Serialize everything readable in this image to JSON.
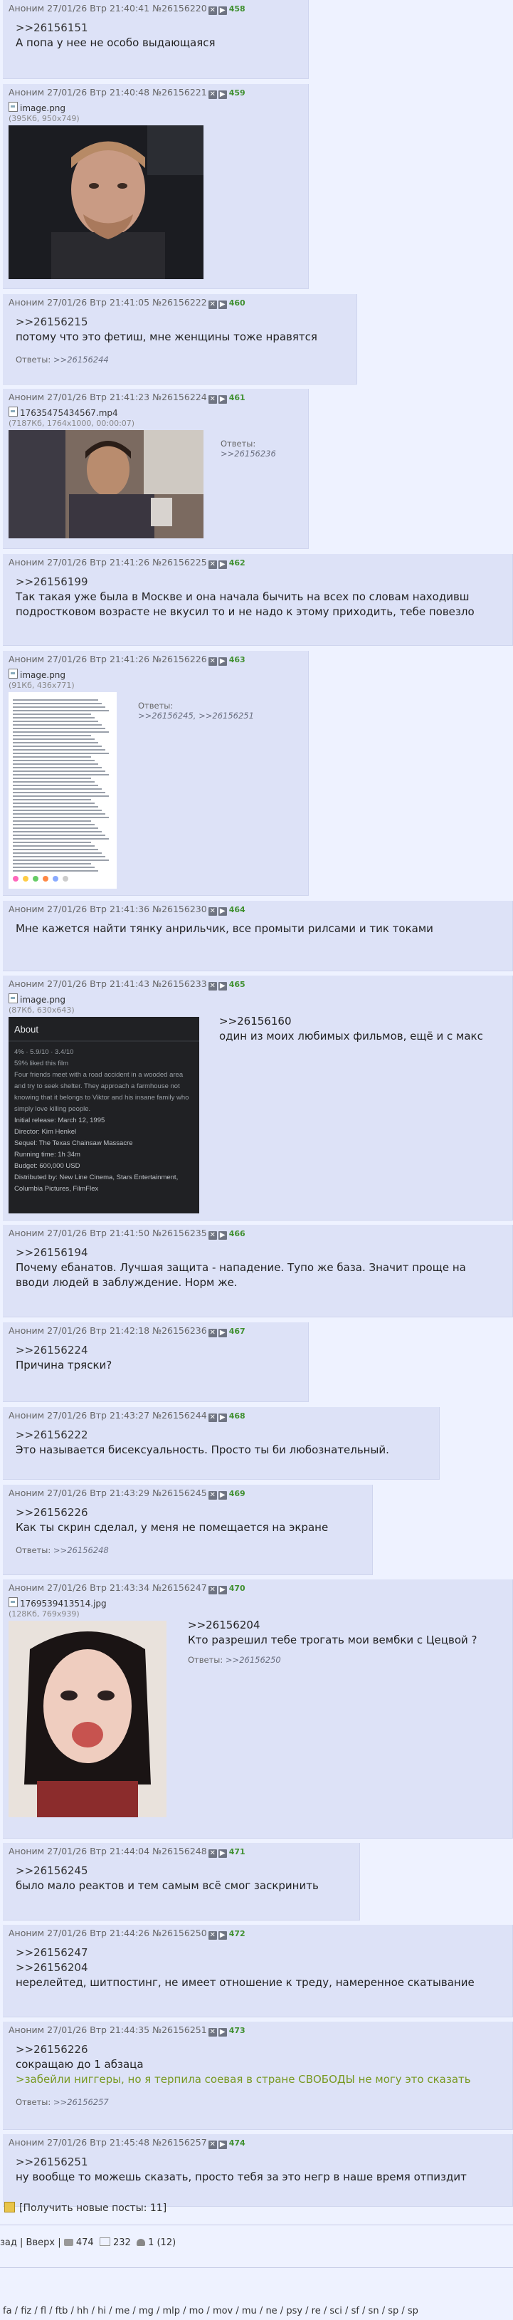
{
  "posts": [
    {
      "head": "Аноним 27/01/26 Втр 21:40:41 №26156220",
      "count": "458",
      "lines": [
        ">>26156151",
        "А попа у нее не особо выдающаяся"
      ],
      "answers": ""
    },
    {
      "head": "Аноним 27/01/26 Втр 21:40:48 №26156221",
      "count": "459",
      "file": "image.png",
      "meta": "(395Кб, 950x749)",
      "lines": [],
      "answers": ""
    },
    {
      "head": "Аноним 27/01/26 Втр 21:41:05 №26156222",
      "count": "460",
      "lines": [
        ">>26156215",
        "потому что это фетиш, мне женщины тоже нравятся"
      ],
      "answers": ">>26156244"
    },
    {
      "head": "Аноним 27/01/26 Втр 21:41:23 №26156224",
      "count": "461",
      "file": "17635475434567.mp4",
      "meta": "(7187Кб, 1764x1000, 00:00:07)",
      "lines": [],
      "answers": ">>26156236"
    },
    {
      "head": "Аноним 27/01/26 Втр 21:41:26 №26156225",
      "count": "462",
      "lines": [
        ">>26156199",
        "Так такая уже была в Москве и она начала бычить на всех по словам находивш",
        "подростковом возрасте не вкусил то и не надо к этому приходить, тебе повезло"
      ],
      "answers": ""
    },
    {
      "head": "Аноним 27/01/26 Втр 21:41:26 №26156226",
      "count": "463",
      "file": "image.png",
      "meta": "(91Кб, 436x771)",
      "lines": [],
      "answers": ">>26156245, >>26156251"
    },
    {
      "head": "Аноним 27/01/26 Втр 21:41:36 №26156230",
      "count": "464",
      "lines": [
        "Мне кажется найти тянку анрильчик, все промыти рилсами и тик токами"
      ],
      "answers": ""
    },
    {
      "head": "Аноним 27/01/26 Втр 21:41:43 №26156233",
      "count": "465",
      "file": "image.png",
      "meta": "(87Кб, 630x643)",
      "lines": [
        ">>26156160",
        "один из моих любимых фильмов, ещё и с макс"
      ],
      "answers": ""
    },
    {
      "head": "Аноним 27/01/26 Втр 21:41:50 №26156235",
      "count": "466",
      "lines": [
        ">>26156194",
        "Почему ебанатов. Лучшая защита - нападение. Тупо же база. Значит проще на",
        "вводи людей в заблуждение. Норм же."
      ],
      "answers": ""
    },
    {
      "head": "Аноним 27/01/26 Втр 21:42:18 №26156236",
      "count": "467",
      "lines": [
        ">>26156224",
        "Причина тряски?"
      ],
      "answers": ""
    },
    {
      "head": "Аноним 27/01/26 Втр 21:43:27 №26156244",
      "count": "468",
      "lines": [
        ">>26156222",
        "Это называется бисексуальность. Просто ты би любознательный."
      ],
      "answers": ""
    },
    {
      "head": "Аноним 27/01/26 Втр 21:43:29 №26156245",
      "count": "469",
      "lines": [
        ">>26156226",
        "Как ты скрин сделал, у меня не помещается на экране"
      ],
      "answers": ">>26156248"
    },
    {
      "head": "Аноним 27/01/26 Втр 21:43:34 №26156247",
      "count": "470",
      "file": "1769539413514.jpg",
      "meta": "(128Кб, 769x939)",
      "lines": [
        ">>26156204",
        "Кто разрешил тебе трогать мои вембки с Цецвой ?"
      ],
      "answers": ">>26156250"
    },
    {
      "head": "Аноним 27/01/26 Втр 21:44:04 №26156248",
      "count": "471",
      "lines": [
        ">>26156245",
        "было мало реактов и тем самым всё смог заскринить"
      ],
      "answers": ""
    },
    {
      "head": "Аноним 27/01/26 Втр 21:44:26 №26156250",
      "count": "472",
      "lines": [
        ">>26156247",
        ">>26156204",
        "нерелейтед, шитпостинг, не имеет отношение к треду, намеренное скатывание"
      ],
      "answers": ""
    },
    {
      "head": "Аноним 27/01/26 Втр 21:44:35 №26156251",
      "count": "473",
      "lines": [
        ">>26156226",
        "сокращаю до 1 абзаца",
        ">забейли ниггеры, но я терпила соевая в стране СВОБОДЫ не могу это сказать"
      ],
      "answers": ">>26156257"
    },
    {
      "head": "Аноним 27/01/26 Втр 21:45:48 №26156257",
      "count": "474",
      "lines": [
        ">>26156251",
        "ну вообще то можешь сказать, просто тебя за это негр в наше время отпиздит"
      ],
      "answers": ""
    }
  ],
  "answers_label": "Ответы:",
  "screenshot_lines": [
    "4% · 5.9/10 · 3.4/10",
    "59% liked this film",
    "Four friends meet with a road accident in a wooded area",
    "and try to seek shelter. They approach a farmhouse not",
    "knowing that it belongs to Viktor and his insane family who",
    "simply love killing people.",
    "Initial release: March 12, 1995",
    "Director: Kim Henkel",
    "Sequel: The Texas Chainsaw Massacre",
    "Running time: 1h 34m",
    "Budget: 600,000 USD",
    "Distributed by: New Line Cinema, Stars Entertainment,",
    "Columbia Pictures, FilmFlex"
  ],
  "screenshot_title": "About",
  "footer": {
    "get_new": "[Получить новые посты: 11]",
    "nav_back": "зад",
    "nav_up": "Вверх",
    "posts_count": "474",
    "files_count": "232",
    "online_count": "1 (12)",
    "boards": "fa / fiz / fl / ftb / hh / hi / me / mg / mlp / mo / mov / mu / ne / psy / re / sci / sf / sn / sp / sp"
  }
}
